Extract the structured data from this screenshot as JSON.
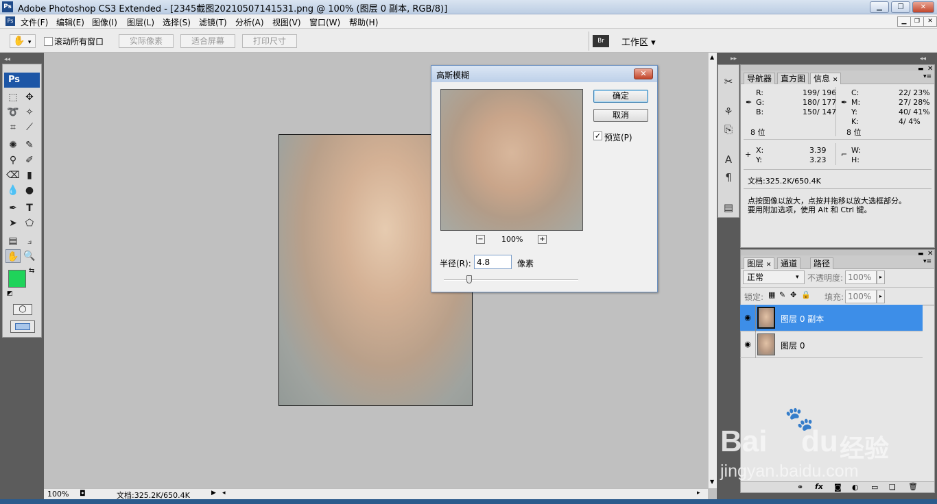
{
  "app": {
    "title": "Adobe Photoshop CS3 Extended - [2345截图20210507141531.png @ 100% (图层 0 副本, RGB/8)]",
    "logo": "Ps"
  },
  "menu": [
    "文件(F)",
    "编辑(E)",
    "图像(I)",
    "图层(L)",
    "选择(S)",
    "滤镜(T)",
    "分析(A)",
    "视图(V)",
    "窗口(W)",
    "帮助(H)"
  ],
  "options": {
    "scroll_all": "滚动所有窗口",
    "actual_pixels": "实际像素",
    "fit_screen": "适合屏幕",
    "print_size": "打印尺寸",
    "workspace": "工作区 ▾",
    "bridge": "Br"
  },
  "colors": {
    "foreground": "#1fd35a",
    "background": "#ffffff",
    "selection": "#3d8ee8"
  },
  "dialog": {
    "title": "高斯模糊",
    "ok": "确定",
    "cancel": "取消",
    "preview_label": "预览(P)",
    "preview_checked": true,
    "zoom": "100%",
    "zoom_minus": "−",
    "zoom_plus": "+",
    "radius_label": "半径(R):",
    "radius_value": "4.8",
    "radius_unit": "像素",
    "slider_fraction": 0.19
  },
  "info_panel": {
    "tabs": [
      "导航器",
      "直方图",
      "信息"
    ],
    "rgb": {
      "R": "199/ 196",
      "G": "180/ 177",
      "B": "150/ 147",
      "bits": "8 位"
    },
    "cmyk": {
      "C": "22/ 23%",
      "M": "27/ 28%",
      "Y": "40/ 41%",
      "K": "4/ 4%",
      "bits": "8 位"
    },
    "xy": {
      "X": "3.39",
      "Y": "3.23"
    },
    "wh": {
      "W": "",
      "H": ""
    },
    "doc": "文档:325.2K/650.4K",
    "hint1": "点按图像以放大，点按并拖移以放大选框部分。",
    "hint2": "要用附加选项，使用 Alt 和 Ctrl 键。"
  },
  "layers_panel": {
    "tabs": [
      "图层",
      "通道",
      "路径"
    ],
    "blend_mode": "正常",
    "opacity_label": "不透明度:",
    "opacity_value": "100%",
    "lock_label": "锁定:",
    "fill_label": "填充:",
    "fill_value": "100%",
    "layers": [
      {
        "name": "图层 0 副本",
        "selected": true
      },
      {
        "name": "图层 0",
        "selected": false
      }
    ]
  },
  "status": {
    "zoom": "100%",
    "doc": "文档:325.2K/650.4K"
  },
  "watermark": {
    "brand": "Bai",
    "brand2": "du",
    "cn": "经验",
    "url": "jingyan.baidu.com"
  }
}
